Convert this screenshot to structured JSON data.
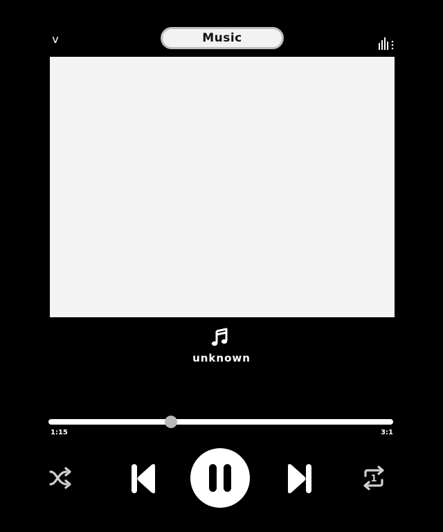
{
  "header": {
    "title": "Music",
    "collapse_glyph": "v",
    "collapse_icon": "chevron-down-icon",
    "menu_icon": "equalizer-menu-icon"
  },
  "artwork": {
    "color": "#f4f4f4"
  },
  "track": {
    "title": "unknown",
    "icon": "music-note-icon"
  },
  "progress": {
    "elapsed": "1:15",
    "total": "3:1",
    "fraction": 0.355
  },
  "controls": {
    "shuffle_icon": "shuffle-icon",
    "previous_icon": "skip-previous-icon",
    "play_state": "playing",
    "pause_icon": "pause-icon",
    "next_icon": "skip-next-icon",
    "repeat_icon": "repeat-one-icon",
    "repeat_badge": "1"
  },
  "colors": {
    "background": "#000000",
    "foreground": "#ffffff",
    "thumb": "#b9b9b9",
    "controls_muted": "#cfcfcf"
  }
}
